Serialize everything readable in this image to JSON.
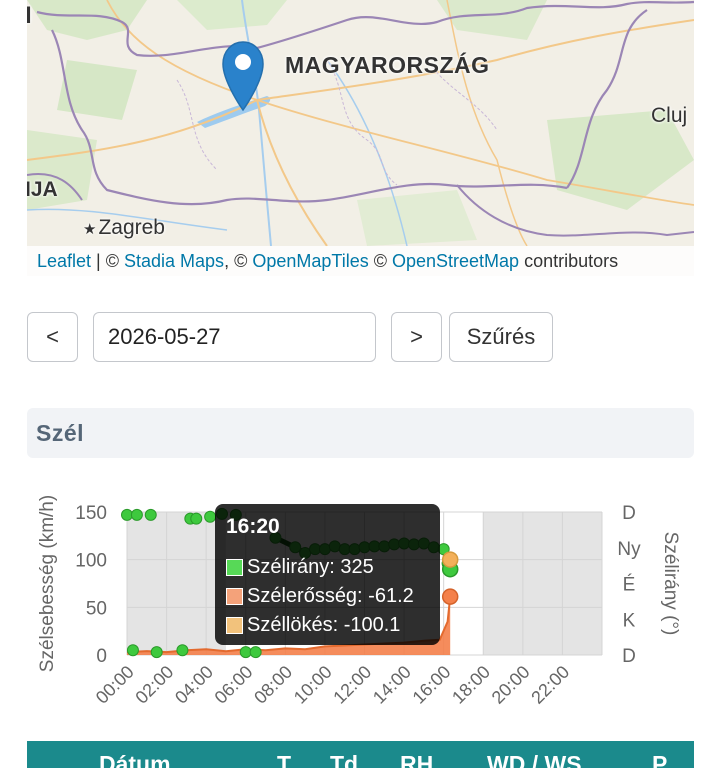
{
  "map": {
    "labels": {
      "country": "MAGYARORSZÁG",
      "cluj": "Cluj",
      "ija": "IJA",
      "i": "I",
      "zagreb": "Zagreb"
    },
    "attribution": {
      "leaflet": "Leaflet",
      "sep": " | © ",
      "stadia": "Stadia Maps",
      "mid": ", © ",
      "omt": "OpenMapTiles",
      "mid2": " © ",
      "osm": "OpenStreetMap",
      "tail": " contributors"
    }
  },
  "controls": {
    "prev_label": "<",
    "date_value": "2026-05-27",
    "next_label": ">",
    "filter_label": "Szűrés"
  },
  "section": {
    "title": "Szél"
  },
  "chart_data": {
    "type": "line",
    "ylabel_left": "Szélsebesség (km/h)",
    "ylabel_right": "Szélirány (°)",
    "yticks_left": [
      "0",
      "50",
      "100",
      "150"
    ],
    "yticks_right": [
      "D",
      "K",
      "É",
      "Ny",
      "D"
    ],
    "xticks": [
      "00:00",
      "02:00",
      "04:00",
      "06:00",
      "08:00",
      "10:00",
      "12:00",
      "14:00",
      "16:00",
      "18:00",
      "20:00",
      "22:00"
    ],
    "ylim": [
      0,
      150
    ],
    "xlim_hours": [
      0,
      24
    ],
    "series": [
      {
        "name": "Szélirány",
        "color": "#3ec93e",
        "x": [
          0,
          0.3,
          0.5,
          1.2,
          1.5,
          2.8,
          3.2,
          3.5,
          4.2,
          4.8,
          5.5,
          6.0,
          6.5,
          7.5,
          8.5,
          9.0,
          9.5,
          10.0,
          10.5,
          11.0,
          11.5,
          12.0,
          12.5,
          13.0,
          13.5,
          14.0,
          14.5,
          15.0,
          15.5,
          16.0,
          16.2,
          16.33
        ],
        "y": [
          147,
          5,
          147,
          147,
          3,
          5,
          143,
          143,
          145,
          148,
          147,
          3,
          3,
          123,
          113,
          107,
          111,
          111,
          114,
          111,
          111,
          113,
          114,
          114,
          116,
          117,
          116,
          117,
          113,
          111,
          96,
          90
        ]
      },
      {
        "name": "Szélerősség",
        "color": "#f4804a",
        "x": [
          0,
          1,
          2,
          3,
          4,
          5,
          6,
          7,
          8,
          9,
          10,
          11,
          12,
          13,
          14,
          15,
          15.8,
          16.2,
          16.33
        ],
        "y": [
          3,
          4,
          3,
          5,
          6,
          4,
          6,
          5,
          7,
          6,
          9,
          10,
          11,
          12,
          13,
          15,
          16,
          35,
          61.2
        ]
      },
      {
        "name": "Széllökés",
        "color": "#f3b05a",
        "x": [
          16.33
        ],
        "y": [
          100.1
        ]
      }
    ],
    "tooltip": {
      "time": "16:20",
      "rows": [
        {
          "label": "Szélirány: 325",
          "color": "#57d957"
        },
        {
          "label": "Szélerősség: -61.2",
          "color": "#f4a27a"
        },
        {
          "label": "Széllökés: -100.1",
          "color": "#f2c27c"
        }
      ]
    }
  },
  "table": {
    "headers": [
      "Dátum",
      "T",
      "Td",
      "RH",
      "WD / WS",
      "P"
    ]
  }
}
